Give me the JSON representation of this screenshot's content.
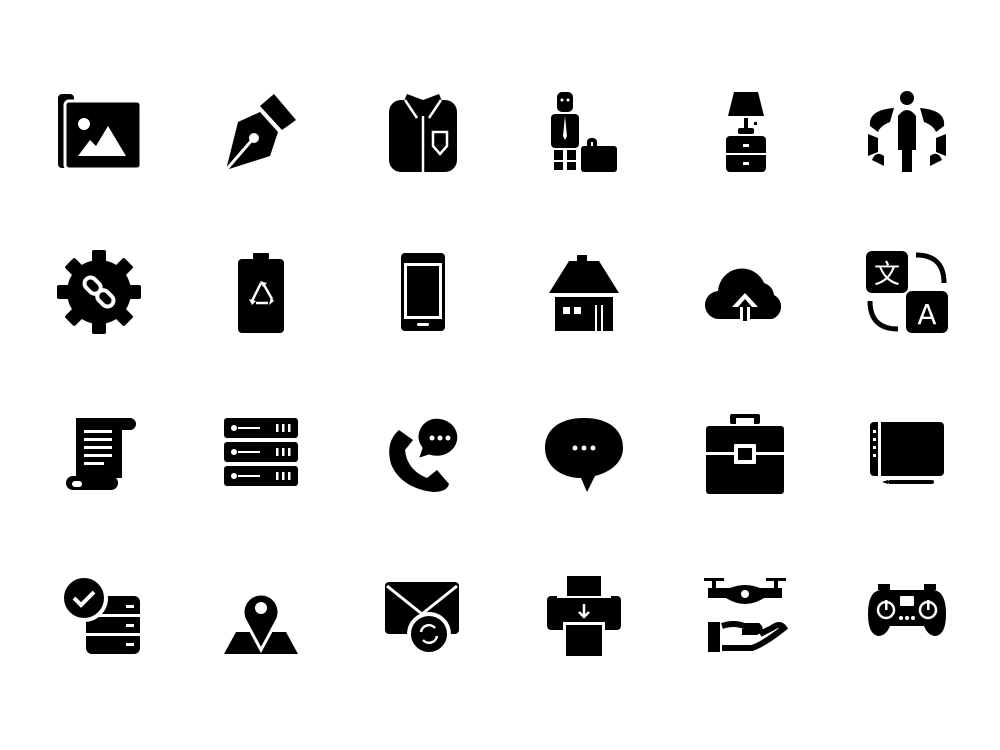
{
  "icon_color": "#000000",
  "background_color": "#ffffff",
  "icons": [
    {
      "name": "image-folder-icon"
    },
    {
      "name": "pen-nib-icon"
    },
    {
      "name": "shirt-icon"
    },
    {
      "name": "businessman-briefcase-icon"
    },
    {
      "name": "lamp-nightstand-icon"
    },
    {
      "name": "person-360-view-icon"
    },
    {
      "name": "gear-link-icon"
    },
    {
      "name": "battery-recycle-icon"
    },
    {
      "name": "smartphone-icon"
    },
    {
      "name": "house-icon"
    },
    {
      "name": "cloud-upload-icon"
    },
    {
      "name": "translate-icon",
      "glyph_a": "文",
      "glyph_b": "A"
    },
    {
      "name": "scroll-document-icon"
    },
    {
      "name": "server-rack-icon"
    },
    {
      "name": "phone-call-chat-icon"
    },
    {
      "name": "speech-bubble-icon"
    },
    {
      "name": "toolbox-icon"
    },
    {
      "name": "drawing-tablet-icon"
    },
    {
      "name": "database-check-icon"
    },
    {
      "name": "map-pin-icon"
    },
    {
      "name": "email-sync-icon"
    },
    {
      "name": "printer-icon"
    },
    {
      "name": "drone-hand-icon"
    },
    {
      "name": "gamepad-icon"
    }
  ]
}
